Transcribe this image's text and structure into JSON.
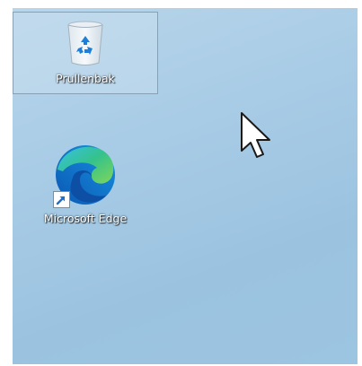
{
  "desktop": {
    "background_color": "#a9cce6",
    "icons": [
      {
        "label": "Prullenbak",
        "icon": "recycle-bin-icon",
        "selected": true
      },
      {
        "label": "Microsoft Edge",
        "icon": "edge-icon",
        "shortcut": true
      }
    ]
  },
  "cursor": {
    "icon": "mouse-pointer-icon"
  }
}
